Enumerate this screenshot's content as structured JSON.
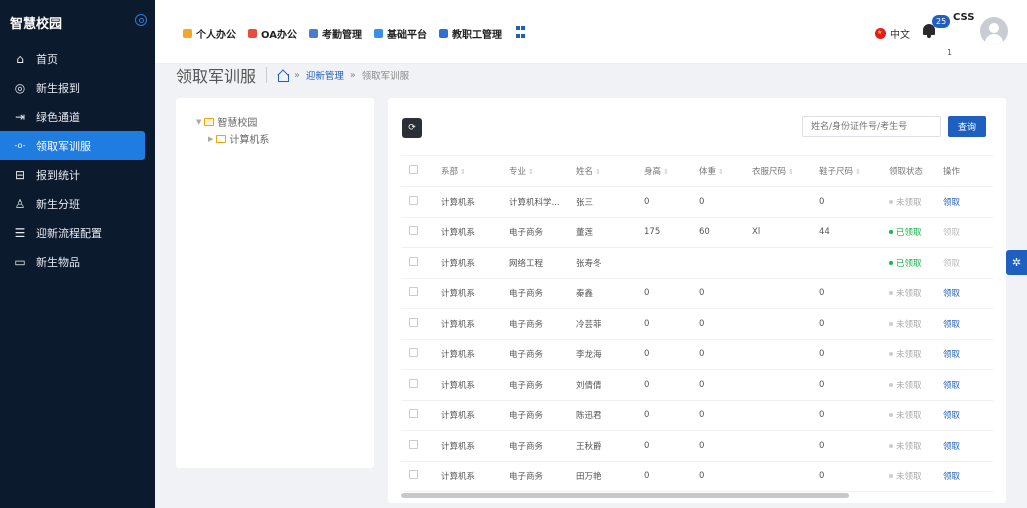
{
  "app": {
    "brand": "智慧校园"
  },
  "sidebar": {
    "items": [
      {
        "label": "首页",
        "icon": "home-icon"
      },
      {
        "label": "新生报到",
        "icon": "target-icon"
      },
      {
        "label": "绿色通道",
        "icon": "login-arrow-icon"
      },
      {
        "label": "领取军训服",
        "icon": "commit-icon",
        "active": true
      },
      {
        "label": "报到统计",
        "icon": "inbox-icon"
      },
      {
        "label": "新生分班",
        "icon": "user-icon"
      },
      {
        "label": "迎新流程配置",
        "icon": "list-icon"
      },
      {
        "label": "新生物品",
        "icon": "box-icon"
      }
    ]
  },
  "topnav": {
    "items": [
      {
        "label": "个人办公",
        "color": "#f5a623"
      },
      {
        "label": "OA办公",
        "color": "#e84c3d"
      },
      {
        "label": "考勤管理",
        "color": "#4a7bd0"
      },
      {
        "label": "基础平台",
        "color": "#3a8ee6"
      },
      {
        "label": "教职工管理",
        "color": "#2f6fd6"
      }
    ],
    "lang": "中文",
    "badge": "25",
    "user_short": "CSS",
    "tiny": "1"
  },
  "breadcrumb": {
    "title": "领取军训服",
    "sep": "»",
    "parent": "迎新管理",
    "current": "领取军训服"
  },
  "tree": {
    "root": "智慧校园",
    "child": "计算机系"
  },
  "toolbar": {
    "search_placeholder": "姓名/身份证件号/考生号",
    "query_label": "查询"
  },
  "table": {
    "columns": [
      "系部",
      "专业",
      "姓名",
      "身高",
      "体重",
      "衣服尺码",
      "鞋子尺码",
      "领取状态",
      "操作"
    ],
    "rows": [
      {
        "dept": "计算机系",
        "major": "计算机科学...",
        "name": "张三",
        "height": "0",
        "weight": "0",
        "cloth": "",
        "shoe": "0",
        "status": "未领取",
        "done": false,
        "op": "领取"
      },
      {
        "dept": "计算机系",
        "major": "电子商务",
        "name": "董莲",
        "height": "175",
        "weight": "60",
        "cloth": "Xl",
        "shoe": "44",
        "status": "已领取",
        "done": true,
        "op": "领取"
      },
      {
        "dept": "计算机系",
        "major": "网络工程",
        "name": "张寿冬",
        "height": "",
        "weight": "",
        "cloth": "",
        "shoe": "",
        "status": "已领取",
        "done": true,
        "op": "领取"
      },
      {
        "dept": "计算机系",
        "major": "电子商务",
        "name": "秦鑫",
        "height": "0",
        "weight": "0",
        "cloth": "",
        "shoe": "0",
        "status": "未领取",
        "done": false,
        "op": "领取"
      },
      {
        "dept": "计算机系",
        "major": "电子商务",
        "name": "冷芸菲",
        "height": "0",
        "weight": "0",
        "cloth": "",
        "shoe": "0",
        "status": "未领取",
        "done": false,
        "op": "领取"
      },
      {
        "dept": "计算机系",
        "major": "电子商务",
        "name": "李龙海",
        "height": "0",
        "weight": "0",
        "cloth": "",
        "shoe": "0",
        "status": "未领取",
        "done": false,
        "op": "领取"
      },
      {
        "dept": "计算机系",
        "major": "电子商务",
        "name": "刘倩倩",
        "height": "0",
        "weight": "0",
        "cloth": "",
        "shoe": "0",
        "status": "未领取",
        "done": false,
        "op": "领取"
      },
      {
        "dept": "计算机系",
        "major": "电子商务",
        "name": "陈迅君",
        "height": "0",
        "weight": "0",
        "cloth": "",
        "shoe": "0",
        "status": "未领取",
        "done": false,
        "op": "领取"
      },
      {
        "dept": "计算机系",
        "major": "电子商务",
        "name": "王秋爵",
        "height": "0",
        "weight": "0",
        "cloth": "",
        "shoe": "0",
        "status": "未领取",
        "done": false,
        "op": "领取"
      },
      {
        "dept": "计算机系",
        "major": "电子商务",
        "name": "田万艳",
        "height": "0",
        "weight": "0",
        "cloth": "",
        "shoe": "0",
        "status": "未领取",
        "done": false,
        "op": "领取"
      }
    ]
  }
}
